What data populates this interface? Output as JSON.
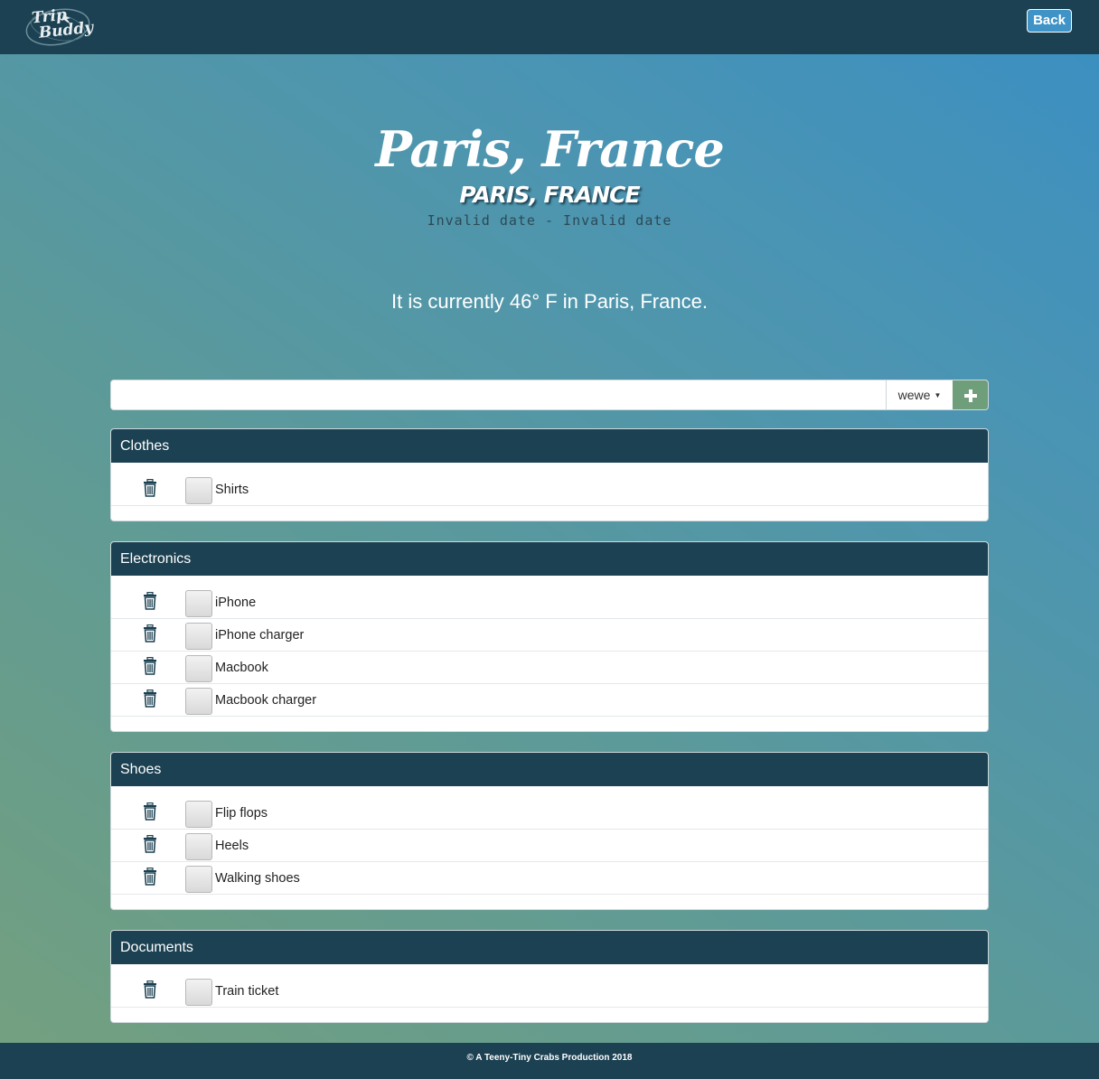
{
  "navbar": {
    "logo_line1": "Trip",
    "logo_line2": "Buddy",
    "back_label": "Back"
  },
  "trip": {
    "title": "Paris, France",
    "subtitle": "Paris, France",
    "dates": "Invalid date - Invalid date",
    "weather": "It is currently 46° F in Paris, France."
  },
  "add_item": {
    "input_value": "",
    "category": "wewe",
    "add_icon": "plus-icon"
  },
  "categories": [
    {
      "name": "Clothes",
      "items": [
        "Shirts"
      ]
    },
    {
      "name": "Electronics",
      "items": [
        "iPhone",
        "iPhone charger",
        "Macbook",
        "Macbook charger"
      ]
    },
    {
      "name": "Shoes",
      "items": [
        "Flip flops",
        "Heels",
        "Walking shoes"
      ]
    },
    {
      "name": "Documents",
      "items": [
        "Train ticket"
      ]
    }
  ],
  "footer": {
    "text": "© A Teeny-Tiny Crabs Production 2018"
  },
  "colors": {
    "navbar": "#1c4152",
    "accent_button": "#3f93c6",
    "add_button": "#6e9e7a"
  }
}
